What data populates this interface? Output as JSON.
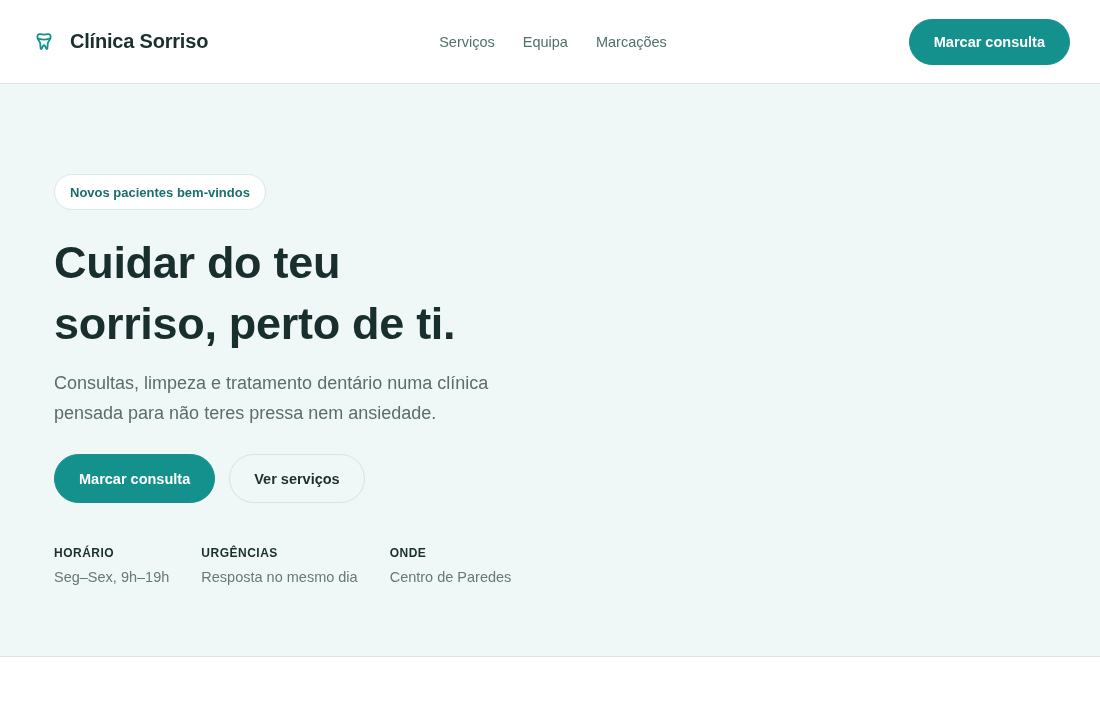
{
  "header": {
    "brand": "Clínica Sorriso",
    "nav": [
      {
        "label": "Serviços"
      },
      {
        "label": "Equipa"
      },
      {
        "label": "Marcações"
      }
    ],
    "cta": "Marcar consulta"
  },
  "hero": {
    "tag": "Novos pacientes bem-vindos",
    "title": "Cuidar do teu sorriso, perto de ti.",
    "lead": "Consultas, limpeza e tratamento dentário numa clínica pensada para não teres pressa nem ansiedade.",
    "buttons": [
      {
        "label": "Marcar consulta",
        "kind": "primary"
      },
      {
        "label": "Ver serviços",
        "kind": "secondary"
      }
    ],
    "facts": [
      {
        "label": "HORÁRIO",
        "value": "Seg–Sex, 9h–19h"
      },
      {
        "label": "URGÊNCIAS",
        "value": "Resposta no mesmo dia"
      },
      {
        "label": "ONDE",
        "value": "Centro de Paredes"
      }
    ]
  }
}
